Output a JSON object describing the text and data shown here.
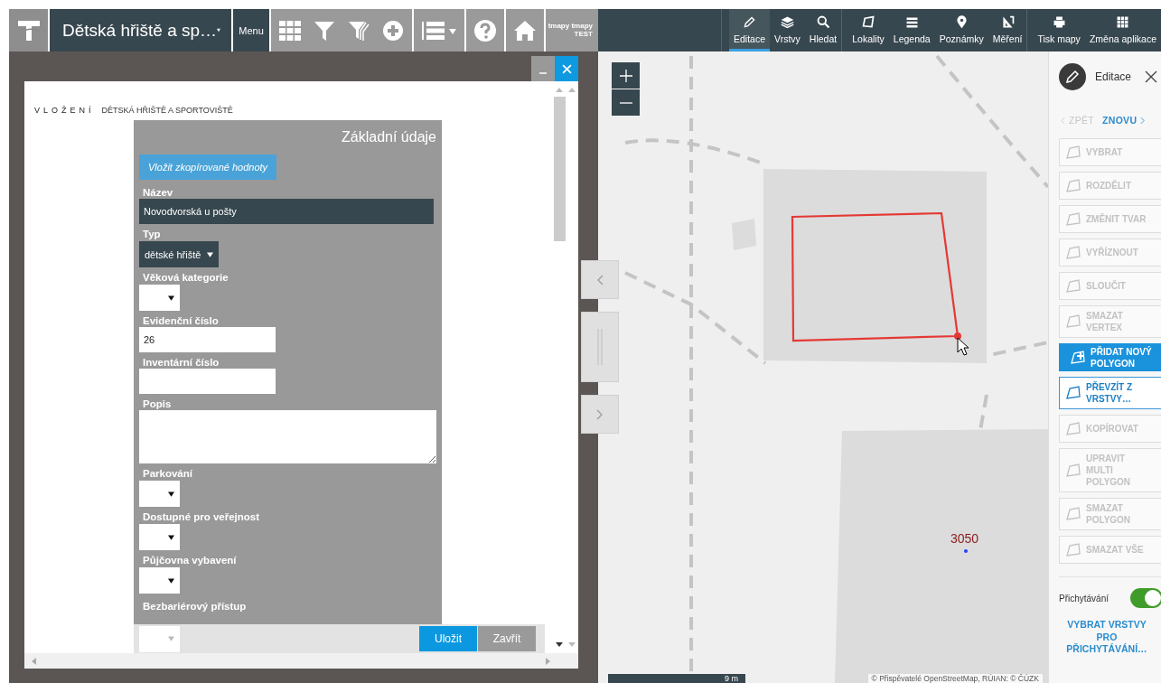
{
  "app_bar": {
    "title": "Dětská hřiště a sp…",
    "menu": "Menu",
    "user": "tmapy tmapy",
    "user_line_2": "TEST"
  },
  "map_toolbar": {
    "groups": [
      {
        "items": [
          {
            "label": "Editace",
            "selected": true
          },
          {
            "label": "Vrstvy",
            "selected": false
          },
          {
            "label": "Hledat",
            "selected": false
          }
        ]
      },
      {
        "items": [
          {
            "label": "Lokality",
            "selected": false
          },
          {
            "label": "Legenda",
            "selected": false
          },
          {
            "label": "Poznámky",
            "selected": false
          },
          {
            "label": "Měření",
            "selected": false
          }
        ]
      },
      {
        "items": [
          {
            "label": "Tisk mapy",
            "selected": false
          },
          {
            "label": "Změna aplikace",
            "selected": false
          }
        ]
      }
    ]
  },
  "dialog": {
    "title_kind": "VLOŽENÍ",
    "title": "DĚTSKÁ HŘIŠTĚ A SPORTOVIŠTĚ",
    "section": "Základní údaje",
    "paste_button": "Vložit zkopírované hodnoty",
    "fields": [
      {
        "label": "Název",
        "kind": "text-dark",
        "value": "Novodvorská u pošty",
        "disabled": false
      },
      {
        "label": "Typ",
        "kind": "select-dark",
        "value": "dětské hřiště",
        "disabled": false
      },
      {
        "label": "Věková kategorie",
        "kind": "select",
        "disabled": false
      },
      {
        "label": "Evidenční číslo",
        "kind": "text",
        "value": "26",
        "disabled": false
      },
      {
        "label": "Inventární číslo",
        "kind": "text",
        "disabled": false
      },
      {
        "label": "Popis",
        "kind": "textarea",
        "disabled": false
      },
      {
        "label": "Parkování",
        "kind": "select",
        "disabled": false
      },
      {
        "label": "Dostupné pro veřejnost",
        "kind": "select",
        "disabled": false
      },
      {
        "label": "Půjčovna vybavení",
        "kind": "select",
        "disabled": false
      },
      {
        "label": "Bezbariérový přístup",
        "kind": "select",
        "disabled": true
      }
    ],
    "save": "Uložit",
    "close": "Zavřít"
  },
  "map": {
    "parcel_label": "3050",
    "scale": "9 m",
    "attribution": "© Přispěvatelé OpenStreetMap, RÚIAN: © ČÚZK"
  },
  "edit_panel": {
    "title": "Editace",
    "undo": {
      "label": "ZPĚT",
      "disabled": true
    },
    "redo": {
      "label": "ZNOVU",
      "disabled": false
    },
    "tools": [
      {
        "label": "VYBRAT",
        "selected": false,
        "disabled": true
      },
      {
        "label": "ROZDĚLIT",
        "selected": false,
        "disabled": true
      },
      {
        "label": "ZMĚNIT TVAR",
        "selected": false,
        "disabled": true
      },
      {
        "label": "VYŘÍZNOUT",
        "selected": false,
        "disabled": true
      },
      {
        "label": "SLOUČIT",
        "selected": false,
        "disabled": true
      },
      {
        "label": "SMAZAT VERTEX",
        "selected": false,
        "disabled": true
      },
      {
        "label": "PŘIDAT NOVÝ POLYGON",
        "selected": true,
        "disabled": false
      },
      {
        "label": "PŘEVZÍT Z VRSTVY…",
        "selected": false,
        "disabled": false
      },
      {
        "label": "KOPÍROVAT",
        "selected": false,
        "disabled": true
      },
      {
        "label": "UPRAVIT MULTI POLYGON",
        "selected": false,
        "disabled": true
      },
      {
        "label": "SMAZAT POLYGON",
        "selected": false,
        "disabled": true
      },
      {
        "label": "SMAZAT VŠE",
        "selected": false,
        "disabled": true
      }
    ],
    "snapping": {
      "label": "Přichytávání",
      "on": true
    },
    "snap_layers_link": "VYBRAT VRSTVY PRO PŘICHYTÁVÁNÍ…"
  }
}
